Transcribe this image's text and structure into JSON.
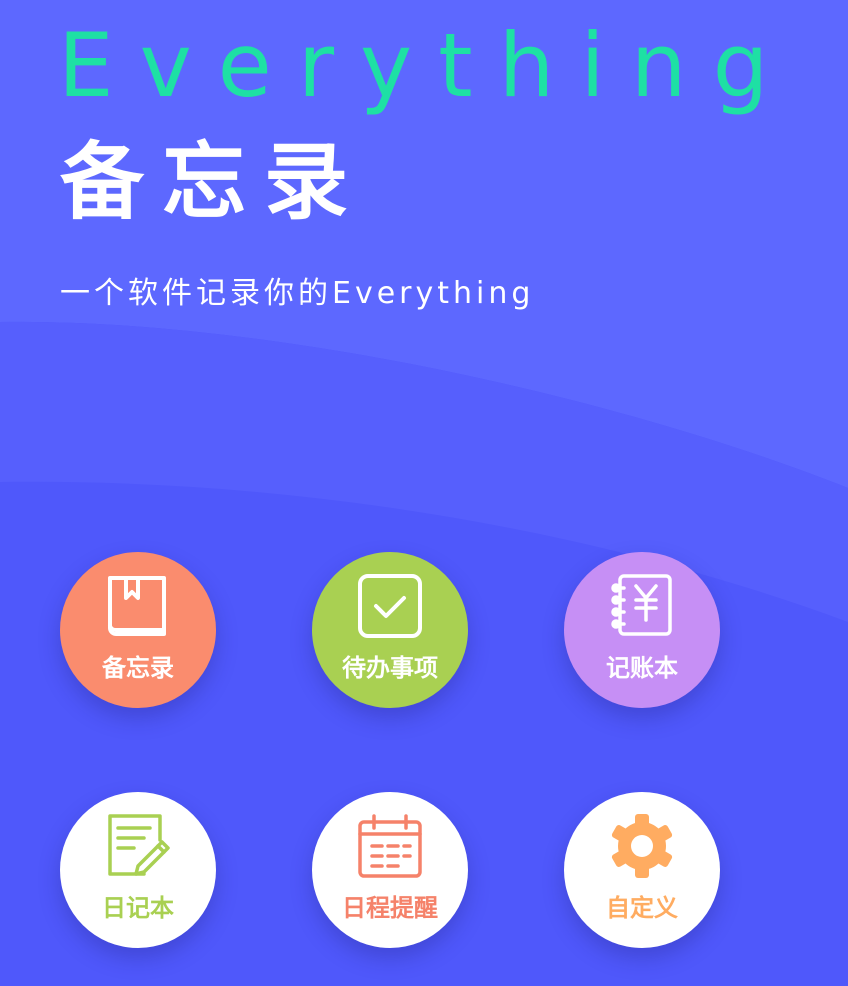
{
  "header": {
    "brand": "Everything",
    "app_title": "备忘录",
    "tagline": "一个软件记录你的Everything"
  },
  "colors": {
    "background": "#4f58fb",
    "background_top": "#5d68ff",
    "brand_text": "#1ee0a4"
  },
  "features": [
    {
      "label": "备忘录",
      "icon": "book-icon",
      "bg": "#fa8c6e",
      "color": "#ffffff"
    },
    {
      "label": "待办事项",
      "icon": "checkbox-icon",
      "bg": "#a9d052",
      "color": "#ffffff"
    },
    {
      "label": "记账本",
      "icon": "ledger-yuan-icon",
      "bg": "#c68ff5",
      "color": "#ffffff"
    },
    {
      "label": "日记本",
      "icon": "diary-pen-icon",
      "bg": "#ffffff",
      "color": "#a9d052"
    },
    {
      "label": "日程提醒",
      "icon": "calendar-icon",
      "bg": "#ffffff",
      "color": "#f5826a"
    },
    {
      "label": "自定义",
      "icon": "gear-icon",
      "bg": "#ffffff",
      "color": "#ffac61"
    }
  ]
}
